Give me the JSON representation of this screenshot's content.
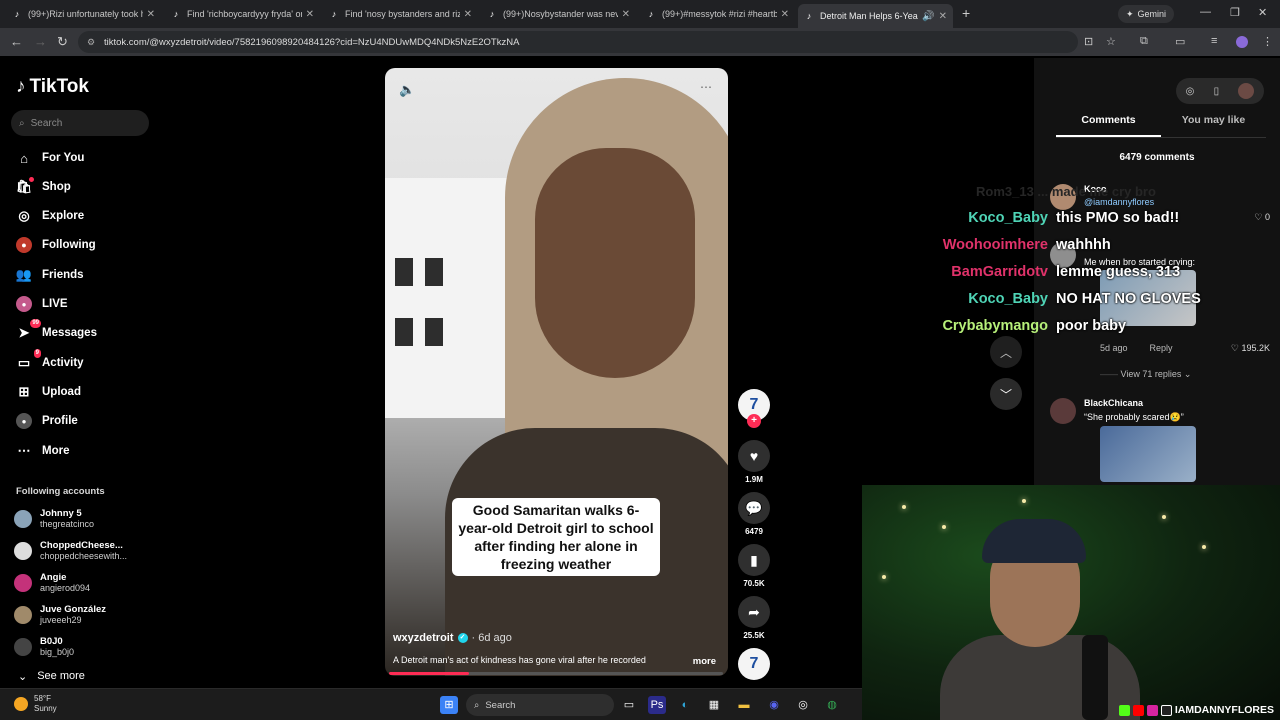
{
  "browser": {
    "tabs": [
      {
        "title": "(99+)Rizi unfortunately took he"
      },
      {
        "title": "Find 'richboycardyyy fryda' on T"
      },
      {
        "title": "Find 'nosy bystanders and rizi'"
      },
      {
        "title": "(99+)Nosybystander was never"
      },
      {
        "title": "(99+)#messytok #rizi #heartbre"
      },
      {
        "title": "Detroit Man Helps 6-Year-O"
      }
    ],
    "gemini_label": "Gemini",
    "url": "tiktok.com/@wxyzdetroit/video/7582196098920484126?cid=NzU4NDUwMDQ4NDk5NzE2OTkzNA"
  },
  "sidebar": {
    "logo": "TikTok",
    "search_placeholder": "Search",
    "nav": [
      {
        "label": "For You",
        "icon": "home-icon"
      },
      {
        "label": "Shop",
        "icon": "shop-icon"
      },
      {
        "label": "Explore",
        "icon": "compass-icon"
      },
      {
        "label": "Following",
        "icon": "following-icon"
      },
      {
        "label": "Friends",
        "icon": "friends-icon"
      },
      {
        "label": "LIVE",
        "icon": "live-icon"
      },
      {
        "label": "Messages",
        "icon": "messages-icon",
        "badge": "99"
      },
      {
        "label": "Activity",
        "icon": "activity-icon",
        "badge": "9"
      },
      {
        "label": "Upload",
        "icon": "upload-icon"
      },
      {
        "label": "Profile",
        "icon": "profile-icon"
      },
      {
        "label": "More",
        "icon": "more-icon"
      }
    ],
    "following_title": "Following accounts",
    "accounts": [
      {
        "name": "Johnny 5",
        "handle": "thegreatcinco"
      },
      {
        "name": "ChoppedCheese...",
        "handle": "choppedcheesewith..."
      },
      {
        "name": "Angie",
        "handle": "angierod094"
      },
      {
        "name": "Juve González",
        "handle": "juveeeh29"
      },
      {
        "name": "B0J0",
        "handle": "big_b0j0"
      }
    ],
    "see_more": "See more"
  },
  "video": {
    "caption": "Good Samaritan walks 6-year-old Detroit girl to school after finding her alone in freezing weather",
    "username": "wxyzdetroit",
    "ago": "· 6d ago",
    "description": "A Detroit man's act of kindness has gone viral after he recorded",
    "more_label": "more",
    "progress": 0.24,
    "likes": "1.9M",
    "comments": "6479",
    "saves": "70.5K",
    "shares": "25.5K",
    "channel_mark": "7"
  },
  "comments_panel": {
    "tab_comments": "Comments",
    "tab_like": "You may like",
    "count": "6479 comments",
    "ghost_text": "Rom3_13 ... made me cry bro",
    "items": [
      {
        "name": "Koco",
        "handle": "@iamdannyflores",
        "likes": "0"
      },
      {
        "name": "",
        "text": "Me when bro started crying:",
        "ago": "5d ago",
        "reply": "Reply",
        "likes": "195.2K",
        "replies": "View 71 replies"
      },
      {
        "name": "BlackChicana",
        "text": "“She probably scared😢”"
      }
    ]
  },
  "chat": [
    {
      "user": "Koco_Baby",
      "color": "#4fd4b6",
      "msg": "this PMO so bad!!"
    },
    {
      "user": "Woohooimhere",
      "color": "#e0326a",
      "msg": "wahhhh"
    },
    {
      "user": "BamGarridotv",
      "color": "#e0326a",
      "msg": "lemme guess, 313"
    },
    {
      "user": "Koco_Baby",
      "color": "#4fd4b6",
      "msg": "NO HAT NO GLOVES"
    },
    {
      "user": "Crybabymango",
      "color": "#b7f07a",
      "msg": "poor baby"
    }
  ],
  "webcam": {
    "handle": "IAMDANNYFLORES"
  },
  "taskbar": {
    "temp": "58°F",
    "condition": "Sunny",
    "search": "Search"
  },
  "colors": {
    "accent": "#fe2c55",
    "verified": "#20d5ec"
  }
}
